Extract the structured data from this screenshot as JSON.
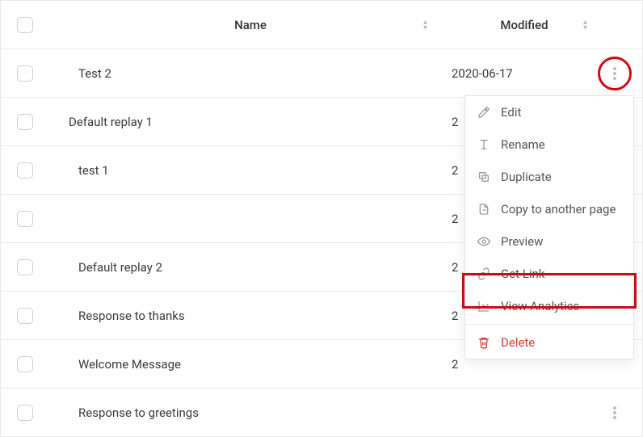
{
  "table": {
    "headers": {
      "name": "Name",
      "modified": "Modified"
    },
    "rows": [
      {
        "name": "Test 2",
        "modified": "2020-06-17",
        "indent": true
      },
      {
        "name": "Default replay 1",
        "modified": "2",
        "indent": false
      },
      {
        "name": "test 1",
        "modified": "2",
        "indent": true
      },
      {
        "name": "",
        "modified": "2",
        "indent": false
      },
      {
        "name": "Default replay 2",
        "modified": "2",
        "indent": true
      },
      {
        "name": "Response to thanks",
        "modified": "2",
        "indent": true
      },
      {
        "name": "Welcome Message",
        "modified": "2",
        "indent": true
      },
      {
        "name": "Response to greetings",
        "modified": "",
        "indent": true
      }
    ]
  },
  "menu": {
    "edit": "Edit",
    "rename": "Rename",
    "duplicate": "Duplicate",
    "copy": "Copy to another page",
    "preview": "Preview",
    "getlink": "Get Link",
    "analytics": "View Analytics",
    "delete": "Delete"
  }
}
